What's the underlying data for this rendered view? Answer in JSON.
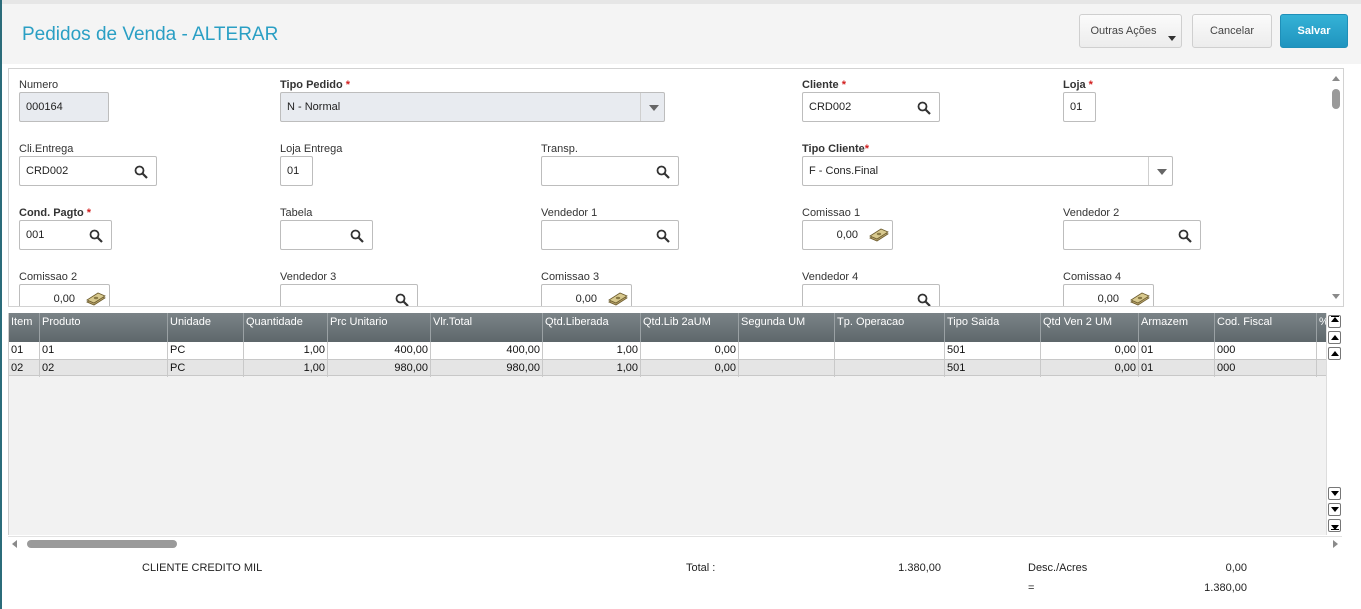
{
  "header": {
    "title": "Pedidos de Venda - ALTERAR",
    "buttons": {
      "outras": "Outras Ações",
      "cancelar": "Cancelar",
      "salvar": "Salvar"
    }
  },
  "form": {
    "numero": {
      "label": "Numero",
      "value": "000164"
    },
    "tipo_pedido": {
      "label": "Tipo Pedido",
      "required": "*",
      "value": "N - Normal"
    },
    "cliente": {
      "label": "Cliente",
      "required": "*",
      "value": "CRD002"
    },
    "loja": {
      "label": "Loja",
      "required": "*",
      "value": "01"
    },
    "cli_entrega": {
      "label": "Cli.Entrega",
      "value": "CRD002"
    },
    "loja_entrega": {
      "label": "Loja Entrega",
      "value": "01"
    },
    "transp": {
      "label": "Transp.",
      "value": ""
    },
    "tipo_cliente": {
      "label": "Tipo Cliente",
      "required": "*",
      "value": "F - Cons.Final"
    },
    "cond_pagto": {
      "label": "Cond. Pagto",
      "required": "*",
      "value": "001"
    },
    "tabela": {
      "label": "Tabela",
      "value": ""
    },
    "vendedor1": {
      "label": "Vendedor 1",
      "value": ""
    },
    "comissao1": {
      "label": "Comissao 1",
      "value": "0,00"
    },
    "vendedor2": {
      "label": "Vendedor 2",
      "value": ""
    },
    "comissao2": {
      "label": "Comissao 2",
      "value": "0,00"
    },
    "vendedor3": {
      "label": "Vendedor 3",
      "value": ""
    },
    "comissao3": {
      "label": "Comissao 3",
      "value": "0,00"
    },
    "vendedor4": {
      "label": "Vendedor 4",
      "value": ""
    },
    "comissao4": {
      "label": "Comissao 4",
      "value": "0,00"
    }
  },
  "grid": {
    "columns": [
      "Item",
      "Produto",
      "Unidade",
      "Quantidade",
      "Prc Unitario",
      "Vlr.Total",
      "Qtd.Liberada",
      "Qtd.Lib 2aUM",
      "Segunda UM",
      "Tp. Operacao",
      "Tipo Saida",
      "Qtd Ven 2 UM",
      "Armazem",
      "Cod. Fiscal",
      "%"
    ],
    "rows": [
      [
        "01",
        "01",
        "PC",
        "1,00",
        "400,00",
        "400,00",
        "1,00",
        "0,00",
        "",
        "",
        "501",
        "0,00",
        "01",
        "000",
        ""
      ],
      [
        "02",
        "02",
        "PC",
        "1,00",
        "980,00",
        "980,00",
        "1,00",
        "0,00",
        "",
        "",
        "501",
        "0,00",
        "01",
        "000",
        ""
      ]
    ]
  },
  "footer": {
    "cliente_nome": "CLIENTE CREDITO MIL",
    "total_label": "Total :",
    "total_value": "1.380,00",
    "desc_label": "Desc./Acres",
    "desc_value": "0,00",
    "eq_label": "=",
    "eq_value": "1.380,00"
  },
  "icons": {
    "lookup": "magnifier-icon",
    "money": "money-icon",
    "dropdown": "chevron-down-icon"
  },
  "colors": {
    "title": "#2a9fc4",
    "primary_button": "#1f94bf",
    "required": "#d21e1e",
    "grid_header": "#6b7478"
  }
}
